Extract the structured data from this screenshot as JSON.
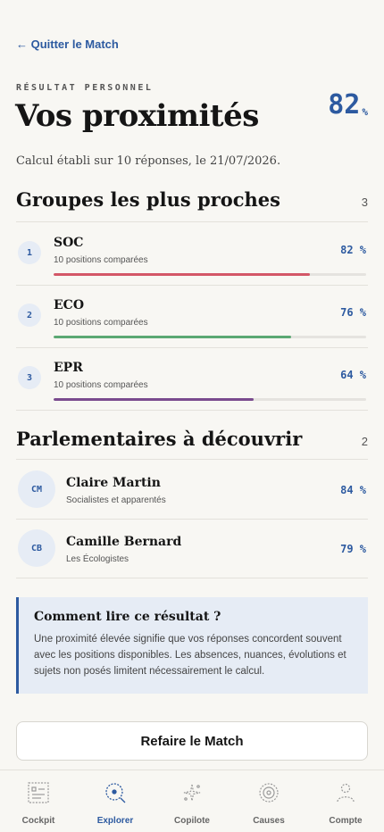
{
  "nav": {
    "back_label": "← Quitter le Match"
  },
  "header": {
    "kicker": "RÉSULTAT PERSONNEL",
    "title": "Vos proximités",
    "score_value": "82",
    "score_unit": "%",
    "subtitle": "Calcul établi sur 10 réponses, le 21/07/2026."
  },
  "groups_section": {
    "heading": "Groupes les plus proches",
    "count": "3",
    "items": [
      {
        "rank": "1",
        "name": "SOC",
        "sub": "10 positions comparées",
        "pct_label": "82 %",
        "value": 82,
        "color": "#d35767"
      },
      {
        "rank": "2",
        "name": "ECO",
        "sub": "10 positions comparées",
        "pct_label": "76 %",
        "value": 76,
        "color": "#5ba873"
      },
      {
        "rank": "3",
        "name": "EPR",
        "sub": "10 positions comparées",
        "pct_label": "64 %",
        "value": 64,
        "color": "#7a4b8e"
      }
    ]
  },
  "mps_section": {
    "heading": "Parlementaires à découvrir",
    "count": "2",
    "items": [
      {
        "initials": "CM",
        "name": "Claire Martin",
        "group": "Socialistes et apparentés",
        "pct_label": "84 %"
      },
      {
        "initials": "CB",
        "name": "Camille Bernard",
        "group": "Les Écologistes",
        "pct_label": "79 %"
      }
    ]
  },
  "info": {
    "title": "Comment lire ce résultat ?",
    "body": "Une proximité élevée signifie que vos réponses concordent souvent avec les positions disponibles. Les absences, nuances, évolutions et sujets non posés limitent nécessairement le calcul."
  },
  "redo_button": "Refaire le Match",
  "tabbar": {
    "tabs": [
      {
        "label": "Cockpit",
        "icon": "cockpit-icon"
      },
      {
        "label": "Explorer",
        "icon": "explorer-icon",
        "active": true
      },
      {
        "label": "Copilote",
        "icon": "copilote-icon"
      },
      {
        "label": "Causes",
        "icon": "causes-icon"
      },
      {
        "label": "Compte",
        "icon": "compte-icon"
      }
    ]
  },
  "colors": {
    "accent": "#2d5aa0",
    "background": "#f8f7f3"
  }
}
